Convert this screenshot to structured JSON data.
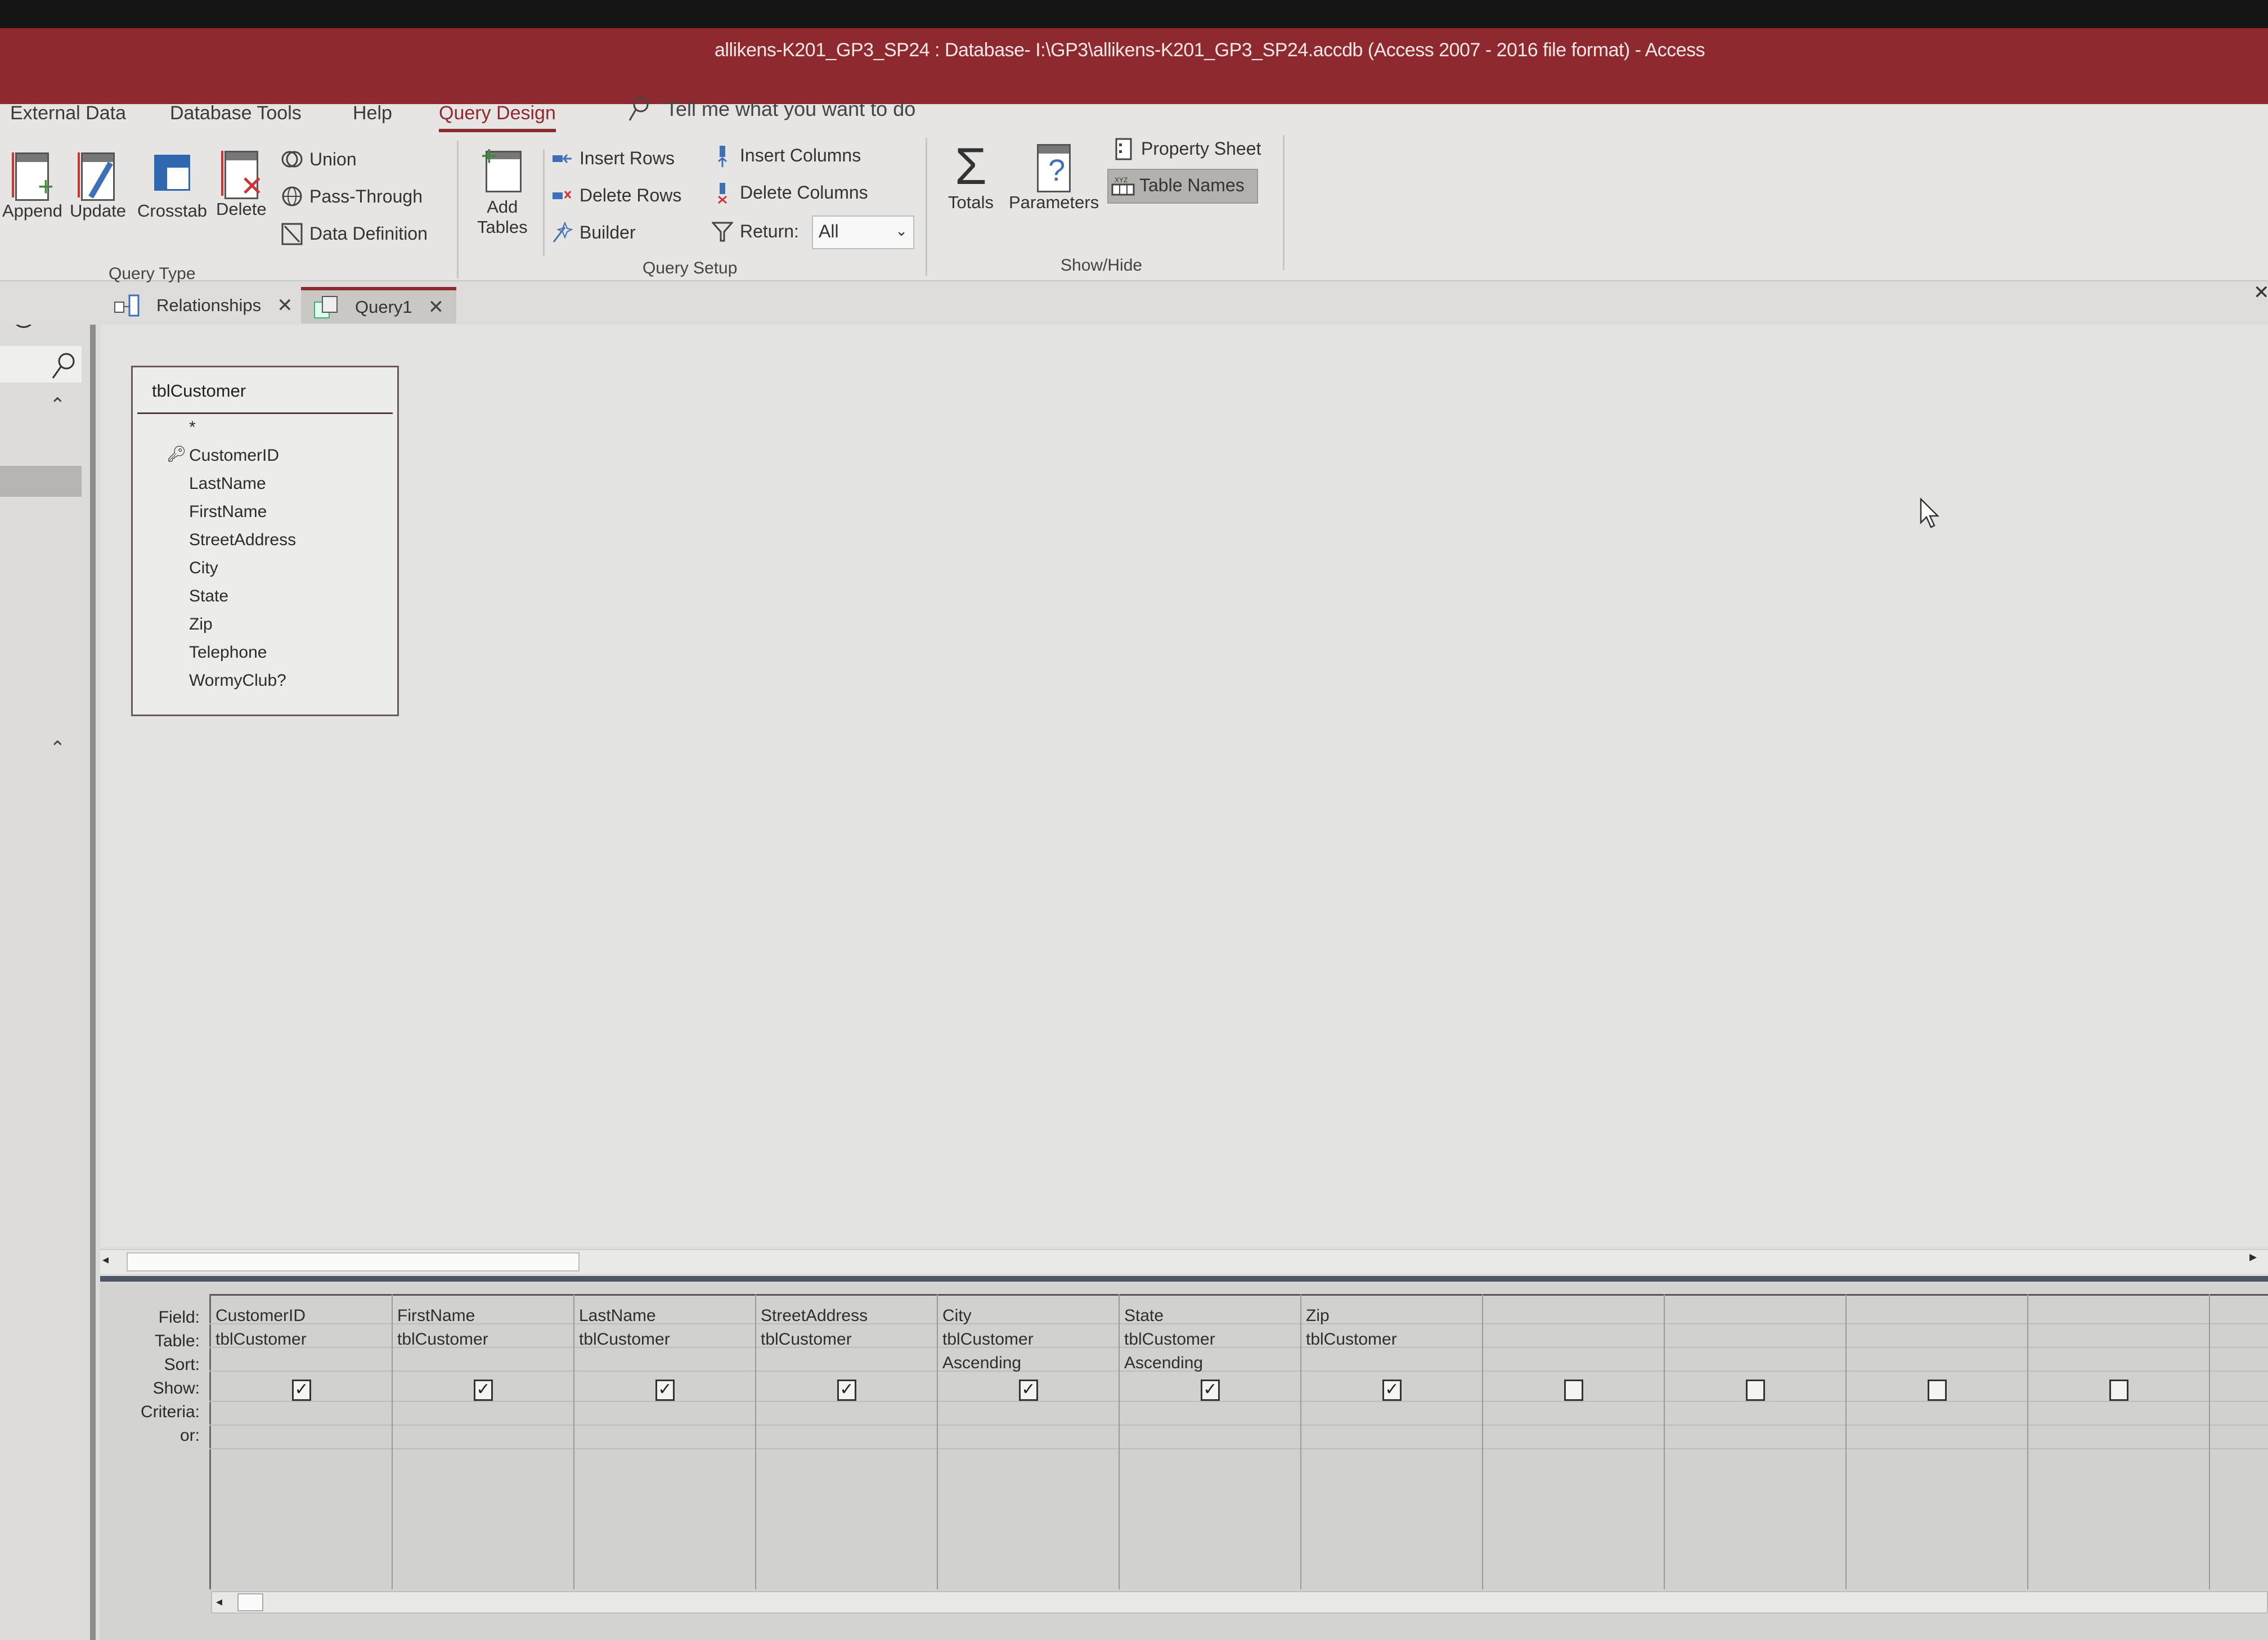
{
  "window": {
    "title": "allikens-K201_GP3_SP24 : Database- I:\\GP3\\allikens-K201_GP3_SP24.accdb (Access 2007 - 2016 file format)  -  Access",
    "accent_color": "#8e2a2f"
  },
  "ribbon": {
    "tabs": [
      {
        "label": "External Data",
        "active": false
      },
      {
        "label": "Database Tools",
        "active": false
      },
      {
        "label": "Help",
        "active": false
      },
      {
        "label": "Query Design",
        "active": true
      }
    ],
    "tell_me": {
      "placeholder": "Tell me what you want to do",
      "icon": "search-icon"
    },
    "groups": {
      "query_type": {
        "label": "Query Type",
        "buttons": [
          {
            "label": "Append",
            "icon": "append-query-icon"
          },
          {
            "label": "Update",
            "icon": "update-query-icon"
          },
          {
            "label": "Crosstab",
            "icon": "crosstab-query-icon"
          },
          {
            "label": "Delete",
            "icon": "delete-query-icon"
          }
        ],
        "small_buttons": [
          {
            "label": "Union",
            "icon": "union-icon"
          },
          {
            "label": "Pass-Through",
            "icon": "globe-icon"
          },
          {
            "label": "Data Definition",
            "icon": "data-definition-icon"
          }
        ]
      },
      "query_setup": {
        "label": "Query Setup",
        "add_tables": {
          "line1": "Add",
          "line2": "Tables",
          "icon": "add-table-icon"
        },
        "small_buttons": [
          {
            "label": "Insert Rows",
            "icon": "insert-rows-icon"
          },
          {
            "label": "Delete Rows",
            "icon": "delete-rows-icon"
          },
          {
            "label": "Builder",
            "icon": "builder-wand-icon"
          },
          {
            "label": "Insert Columns",
            "icon": "insert-columns-icon"
          },
          {
            "label": "Delete Columns",
            "icon": "delete-columns-icon"
          }
        ],
        "return": {
          "label": "Return:",
          "value": "All",
          "icon": "filter-icon"
        }
      },
      "show_hide": {
        "label": "Show/Hide",
        "buttons": [
          {
            "label": "Totals",
            "icon": "sigma-icon"
          },
          {
            "label": "Parameters",
            "icon": "parameters-icon"
          }
        ],
        "small_buttons": [
          {
            "label": "Property Sheet",
            "icon": "property-sheet-icon",
            "active": false
          },
          {
            "label": "Table Names",
            "icon": "table-names-icon",
            "active": true
          }
        ]
      }
    }
  },
  "document_tabs": [
    {
      "label": "Relationships",
      "icon": "relationships-icon",
      "active": false
    },
    {
      "label": "Query1",
      "icon": "query-icon",
      "active": true
    }
  ],
  "table_box": {
    "title": "tblCustomer",
    "fields": [
      "*",
      "CustomerID",
      "LastName",
      "FirstName",
      "StreetAddress",
      "City",
      "State",
      "Zip",
      "Telephone",
      "WormyClub?"
    ],
    "primary_key": "CustomerID"
  },
  "design_grid": {
    "row_labels": [
      "Field:",
      "Table:",
      "Sort:",
      "Show:",
      "Criteria:",
      "or:"
    ],
    "columns": [
      {
        "field": "CustomerID",
        "table": "tblCustomer",
        "sort": "",
        "show": true,
        "criteria": ""
      },
      {
        "field": "FirstName",
        "table": "tblCustomer",
        "sort": "",
        "show": true,
        "criteria": ""
      },
      {
        "field": "LastName",
        "table": "tblCustomer",
        "sort": "",
        "show": true,
        "criteria": ""
      },
      {
        "field": "StreetAddress",
        "table": "tblCustomer",
        "sort": "",
        "show": true,
        "criteria": ""
      },
      {
        "field": "City",
        "table": "tblCustomer",
        "sort": "Ascending",
        "show": true,
        "criteria": ""
      },
      {
        "field": "State",
        "table": "tblCustomer",
        "sort": "Ascending",
        "show": true,
        "criteria": ""
      },
      {
        "field": "Zip",
        "table": "tblCustomer",
        "sort": "",
        "show": true,
        "criteria": ""
      },
      {
        "field": "",
        "table": "",
        "sort": "",
        "show": false,
        "criteria": ""
      },
      {
        "field": "",
        "table": "",
        "sort": "",
        "show": false,
        "criteria": ""
      },
      {
        "field": "",
        "table": "",
        "sort": "",
        "show": false,
        "criteria": ""
      },
      {
        "field": "",
        "table": "",
        "sort": "",
        "show": false,
        "criteria": ""
      }
    ]
  }
}
